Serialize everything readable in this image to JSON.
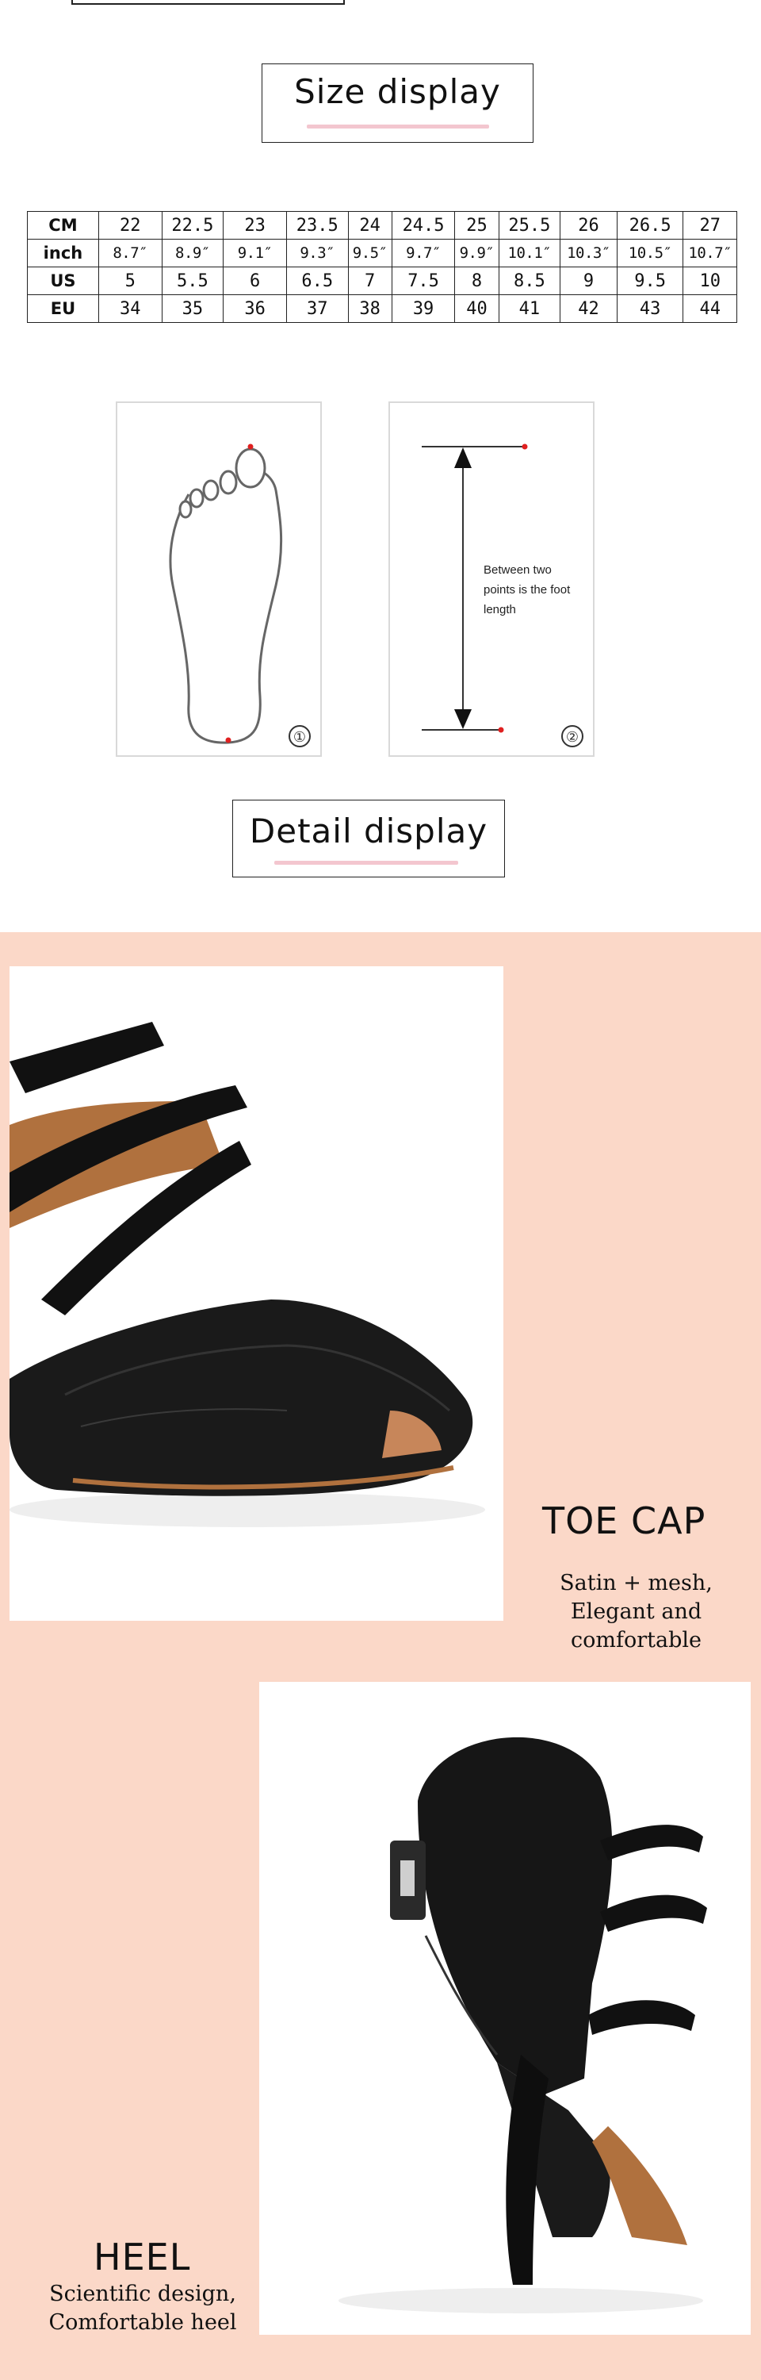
{
  "size_section": {
    "title": "Size display"
  },
  "size_table": {
    "rows": [
      {
        "label": "CM",
        "cells": [
          "22",
          "22.5",
          "23",
          "23.5",
          "24",
          "24.5",
          "25",
          "25.5",
          "26",
          "26.5",
          "27"
        ]
      },
      {
        "label": "inch",
        "cells": [
          "8.7″",
          "8.9″",
          "9.1″",
          "9.3″",
          "9.5″",
          "9.7″",
          "9.9″",
          "10.1″",
          "10.3″",
          "10.5″",
          "10.7″"
        ]
      },
      {
        "label": "US",
        "cells": [
          "5",
          "5.5",
          "6",
          "6.5",
          "7",
          "7.5",
          "8",
          "8.5",
          "9",
          "9.5",
          "10"
        ]
      },
      {
        "label": "EU",
        "cells": [
          "34",
          "35",
          "36",
          "37",
          "38",
          "39",
          "40",
          "41",
          "42",
          "43",
          "44"
        ]
      }
    ]
  },
  "measure": {
    "card1_number": "①",
    "card2_number": "②",
    "between_text": "Between two points is the foot length"
  },
  "detail_section": {
    "title": "Detail display"
  },
  "toe_cap": {
    "title": "TOE CAP",
    "line1": "Satin + mesh,",
    "line2": "Elegant and comfortable"
  },
  "heel": {
    "title": "HEEL",
    "line1": "Scientific design,",
    "line2": "Comfortable heel"
  },
  "colors": {
    "peach_background": "#fbd8c8",
    "underline_pink": "#f3c6cf",
    "shoe_black": "#111111",
    "insole_brown": "#b0713e"
  }
}
